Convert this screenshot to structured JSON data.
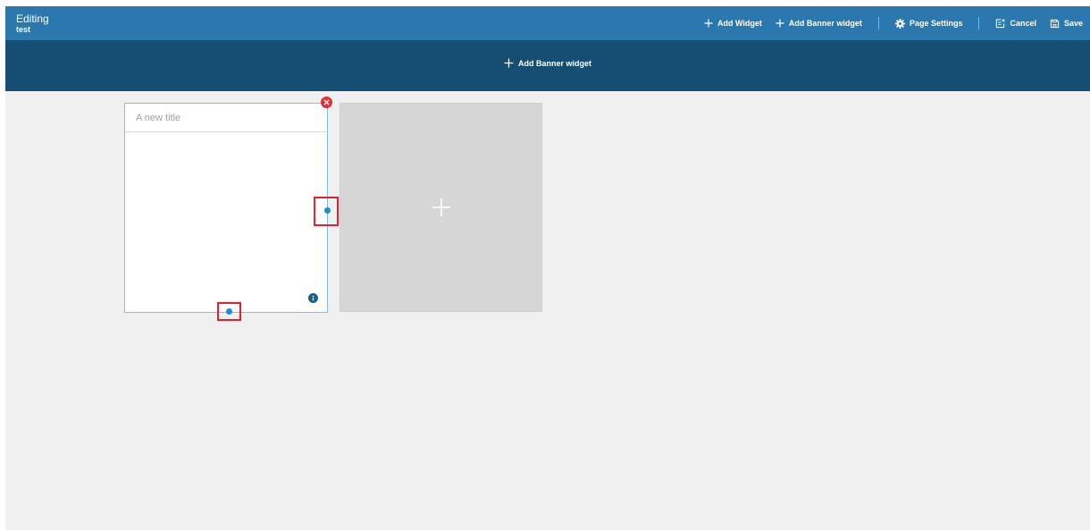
{
  "header": {
    "mode_label": "Editing",
    "page_name": "test"
  },
  "toolbar": {
    "add_widget": "Add Widget",
    "add_banner_widget": "Add Banner widget",
    "page_settings": "Page Settings",
    "cancel": "Cancel",
    "save": "Save"
  },
  "banner": {
    "add_banner_widget": "Add Banner widget"
  },
  "widget": {
    "title_placeholder": "A new title",
    "title_value": ""
  },
  "icons": {
    "add": "plus-icon",
    "settings": "gear-icon",
    "cancel": "cancel-icon",
    "save": "save-icon",
    "remove": "close-icon",
    "info": "info-icon"
  },
  "colors": {
    "topbar": "#2a78ad",
    "banner": "#164d72",
    "canvas": "#f0f0f0",
    "remove": "#e52d33",
    "handle": "#1a8fd8",
    "highlight": "#e52130",
    "placeholder_tile": "#d6d6d6"
  }
}
